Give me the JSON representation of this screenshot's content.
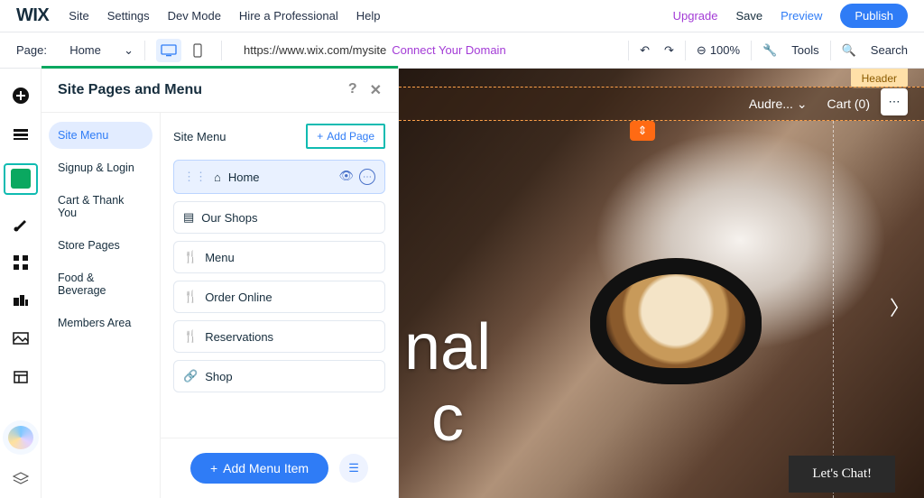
{
  "topbar": {
    "logo": "WIX",
    "menu": [
      "Site",
      "Settings",
      "Dev Mode",
      "Hire a Professional",
      "Help"
    ],
    "upgrade": "Upgrade",
    "save": "Save",
    "preview": "Preview",
    "publish": "Publish"
  },
  "secondbar": {
    "page_label": "Page:",
    "current_page": "Home",
    "url": "https://www.wix.com/mysite",
    "connect_domain": "Connect Your Domain",
    "zoom": "100%",
    "tools": "Tools",
    "search": "Search"
  },
  "panel": {
    "title": "Site Pages and Menu",
    "left": [
      "Site Menu",
      "Signup & Login",
      "Cart & Thank You",
      "Store Pages",
      "Food & Beverage",
      "Members Area"
    ],
    "right_title": "Site Menu",
    "add_page": "Add Page",
    "pages": [
      {
        "label": "Home",
        "icon": "home"
      },
      {
        "label": "Our Shops",
        "icon": "clipboard"
      },
      {
        "label": "Menu",
        "icon": "fork"
      },
      {
        "label": "Order Online",
        "icon": "fork"
      },
      {
        "label": "Reservations",
        "icon": "fork"
      },
      {
        "label": "Shop",
        "icon": "link"
      }
    ],
    "add_menu_item": "Add Menu Item"
  },
  "canvas": {
    "header_badge": "Header",
    "nav_user": "Audre...",
    "cart": "Cart (0)",
    "hero_line1": "nal",
    "hero_line2": "c",
    "chat": "Let's Chat!"
  }
}
